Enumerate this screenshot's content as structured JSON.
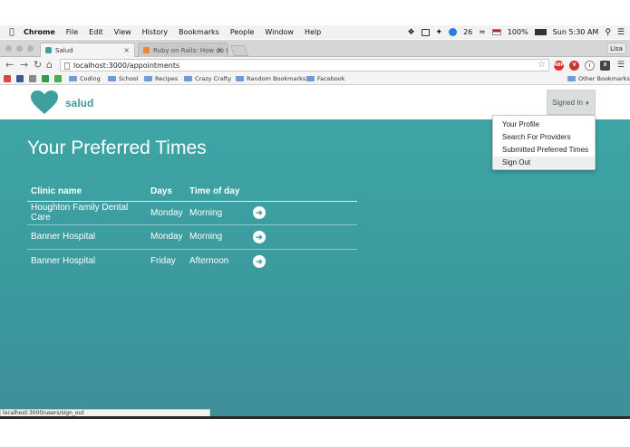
{
  "menubar": {
    "items": [
      "Chrome",
      "File",
      "Edit",
      "View",
      "History",
      "Bookmarks",
      "People",
      "Window",
      "Help"
    ],
    "badge_count": "26",
    "battery": "100%",
    "clock": "Sun 5:30 AM"
  },
  "browser": {
    "tabs": [
      {
        "title": "Salud",
        "active": true
      },
      {
        "title": "Ruby on Rails: How do I alt",
        "active": false
      }
    ],
    "profile_label": "Lisa",
    "url": "localhost:3000/appointments",
    "bookmarks": [
      "Coding",
      "School",
      "Recipes",
      "Crazy Crafty",
      "Random Bookmarks",
      "Facebook"
    ],
    "other_bookmarks": "Other Bookmarks",
    "status_url": "localhost:3000/users/sign_out"
  },
  "app": {
    "brand": "salud",
    "signed_in_label": "Signed In",
    "dropdown": [
      "Your Profile",
      "Search For Providers",
      "Submitted Preferred Times",
      "Sign Out"
    ],
    "page_title": "Your Preferred Times",
    "table": {
      "headers": [
        "Clinic name",
        "Days",
        "Time of day"
      ],
      "rows": [
        {
          "clinic": "Houghton Family Dental Care",
          "day": "Monday",
          "time": "Morning"
        },
        {
          "clinic": "Banner Hospital",
          "day": "Monday",
          "time": "Morning"
        },
        {
          "clinic": "Banner Hospital",
          "day": "Friday",
          "time": "Afternoon"
        }
      ]
    }
  },
  "colors": {
    "teal": "#3fa5a5",
    "brand_text": "#3f9a9d",
    "heart": "#3f9ea0"
  },
  "icons": [
    "apple-icon",
    "dropbox-icon",
    "heart-logo-icon",
    "arrow-right-circle-icon",
    "star-icon",
    "folder-icon",
    "menu-icon"
  ]
}
